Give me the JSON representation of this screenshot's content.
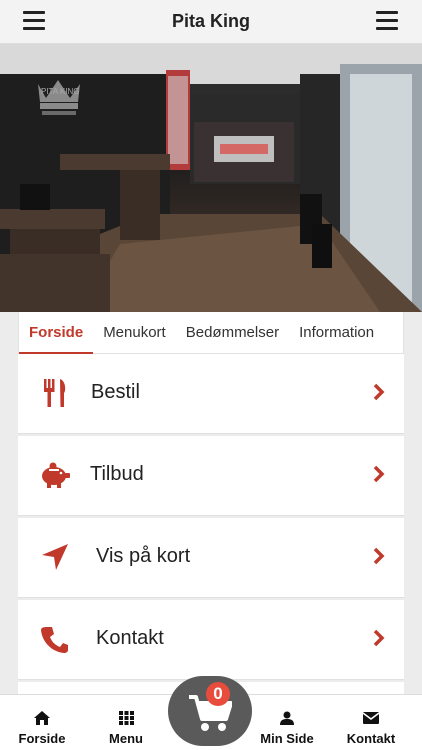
{
  "header": {
    "title": "Pita King"
  },
  "hero": {
    "sign_text": "PITA KING"
  },
  "tabs": [
    {
      "label": "Forside",
      "active": true
    },
    {
      "label": "Menukort",
      "active": false
    },
    {
      "label": "Bedømmelser",
      "active": false
    },
    {
      "label": "Information",
      "active": false
    }
  ],
  "menu": [
    {
      "label": "Bestil",
      "icon": "cutlery-icon"
    },
    {
      "label": "Tilbud",
      "icon": "piggy-bank-icon"
    },
    {
      "label": "Vis på kort",
      "icon": "location-arrow-icon"
    },
    {
      "label": "Kontakt",
      "icon": "phone-icon"
    }
  ],
  "bottom_nav": [
    {
      "label": "Forside",
      "icon": "home-icon"
    },
    {
      "label": "Menu",
      "icon": "grid-icon"
    },
    {
      "label": "Min Side",
      "icon": "user-icon"
    },
    {
      "label": "Kontakt",
      "icon": "envelope-icon"
    }
  ],
  "cart": {
    "count": "0",
    "icon": "shopping-cart-icon"
  },
  "colors": {
    "accent": "#c0392b",
    "badge": "#e74c3c",
    "cart_bg": "#5a5a5a"
  }
}
